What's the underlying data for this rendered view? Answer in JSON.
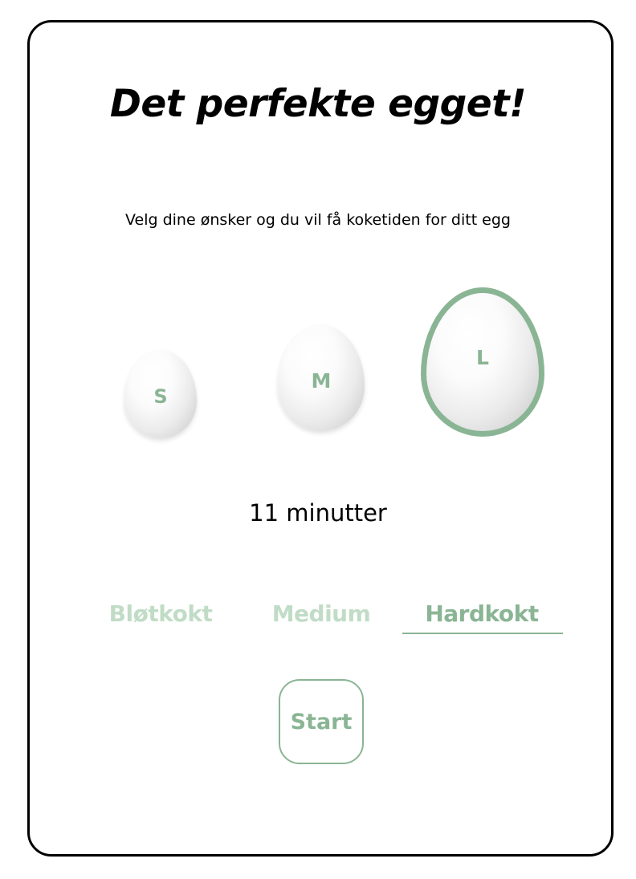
{
  "app": {
    "title": "Det perfekte egget!",
    "subtitle": "Velg dine ønsker og du vil få koketiden for ditt egg"
  },
  "eggs": {
    "selected": "L",
    "sizes": [
      {
        "label": "S"
      },
      {
        "label": "M"
      },
      {
        "label": "L"
      }
    ]
  },
  "cook_time": "11 minutter",
  "doneness": {
    "selected": "Hardkokt",
    "options": [
      {
        "label": "Bløtkokt"
      },
      {
        "label": "Medium"
      },
      {
        "label": "Hardkokt"
      }
    ]
  },
  "actions": {
    "start_label": "Start"
  },
  "colors": {
    "accent": "#8ab594",
    "accent_light": "#c1dcc6",
    "text": "#000000",
    "frame_border": "#000000",
    "background": "#ffffff"
  }
}
